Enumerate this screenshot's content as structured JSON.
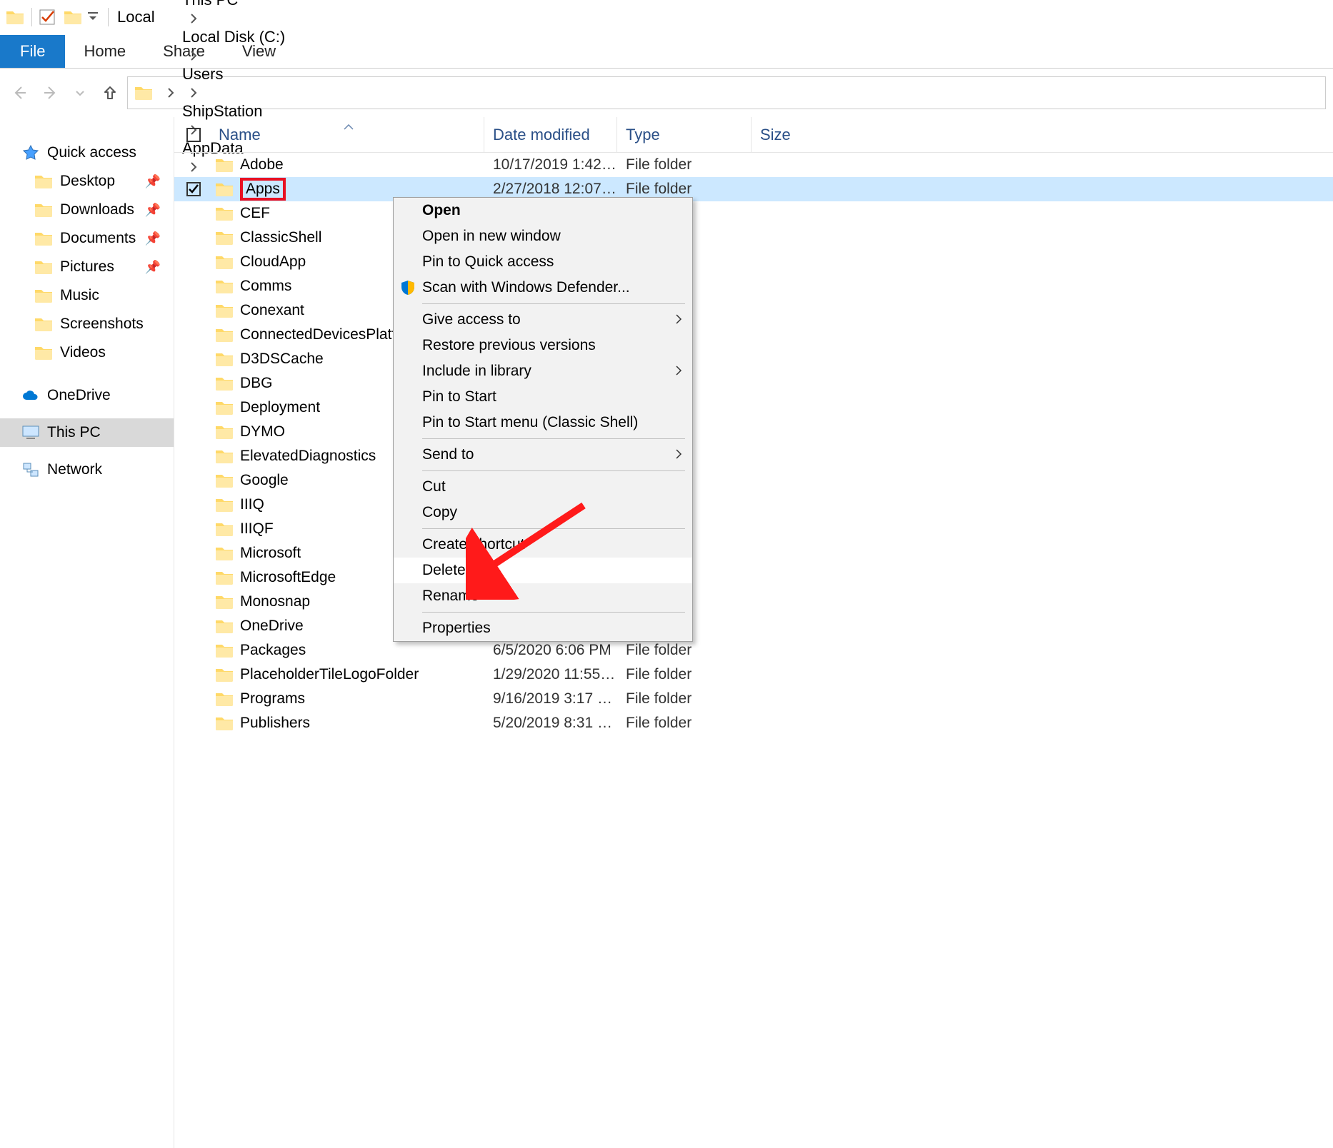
{
  "titlebar": {
    "title": "Local"
  },
  "ribbon": {
    "file": "File",
    "tabs": [
      "Home",
      "Share",
      "View"
    ]
  },
  "breadcrumb": [
    "This PC",
    "Local Disk (C:)",
    "Users",
    "ShipStation",
    "AppData",
    "Local"
  ],
  "columns": {
    "name": "Name",
    "date": "Date modified",
    "type": "Type",
    "size": "Size"
  },
  "sidebar": {
    "quick": "Quick access",
    "items": [
      "Desktop",
      "Downloads",
      "Documents",
      "Pictures",
      "Music",
      "Screenshots",
      "Videos"
    ],
    "onedrive": "OneDrive",
    "thispc": "This PC",
    "network": "Network"
  },
  "files": [
    {
      "name": "Adobe",
      "date": "10/17/2019 1:42 P...",
      "type": "File folder",
      "selected": false
    },
    {
      "name": "Apps",
      "date": "2/27/2018 12:07 P...",
      "type": "File folder",
      "selected": true,
      "highlight": true
    },
    {
      "name": "CEF",
      "date": "",
      "type": ""
    },
    {
      "name": "ClassicShell",
      "date": "",
      "type": ""
    },
    {
      "name": "CloudApp",
      "date": "",
      "type": ""
    },
    {
      "name": "Comms",
      "date": "",
      "type": ""
    },
    {
      "name": "Conexant",
      "date": "",
      "type": ""
    },
    {
      "name": "ConnectedDevicesPlatform",
      "date": "",
      "type": ""
    },
    {
      "name": "D3DSCache",
      "date": "",
      "type": ""
    },
    {
      "name": "DBG",
      "date": "",
      "type": ""
    },
    {
      "name": "Deployment",
      "date": "",
      "type": ""
    },
    {
      "name": "DYMO",
      "date": "",
      "type": ""
    },
    {
      "name": "ElevatedDiagnostics",
      "date": "",
      "type": ""
    },
    {
      "name": "Google",
      "date": "",
      "type": ""
    },
    {
      "name": "IIIQ",
      "date": "",
      "type": ""
    },
    {
      "name": "IIIQF",
      "date": "",
      "type": ""
    },
    {
      "name": "Microsoft",
      "date": "",
      "type": ""
    },
    {
      "name": "MicrosoftEdge",
      "date": "",
      "type": ""
    },
    {
      "name": "Monosnap",
      "date": "",
      "type": ""
    },
    {
      "name": "OneDrive",
      "date": "",
      "type": ""
    },
    {
      "name": "Packages",
      "date": "6/5/2020 6:06 PM",
      "type": "File folder"
    },
    {
      "name": "PlaceholderTileLogoFolder",
      "date": "1/29/2020 11:55 A...",
      "type": "File folder"
    },
    {
      "name": "Programs",
      "date": "9/16/2019 3:17 PM",
      "type": "File folder"
    },
    {
      "name": "Publishers",
      "date": "5/20/2019 8:31 PM",
      "type": "File folder"
    }
  ],
  "context_menu": {
    "open": "Open",
    "open_new": "Open in new window",
    "pin_quick": "Pin to Quick access",
    "defender": "Scan with Windows Defender...",
    "give_access": "Give access to",
    "restore": "Restore previous versions",
    "include_lib": "Include in library",
    "pin_start": "Pin to Start",
    "pin_start_classic": "Pin to Start menu (Classic Shell)",
    "send_to": "Send to",
    "cut": "Cut",
    "copy": "Copy",
    "create_shortcut": "Create shortcut",
    "delete": "Delete",
    "rename": "Rename",
    "properties": "Properties"
  }
}
